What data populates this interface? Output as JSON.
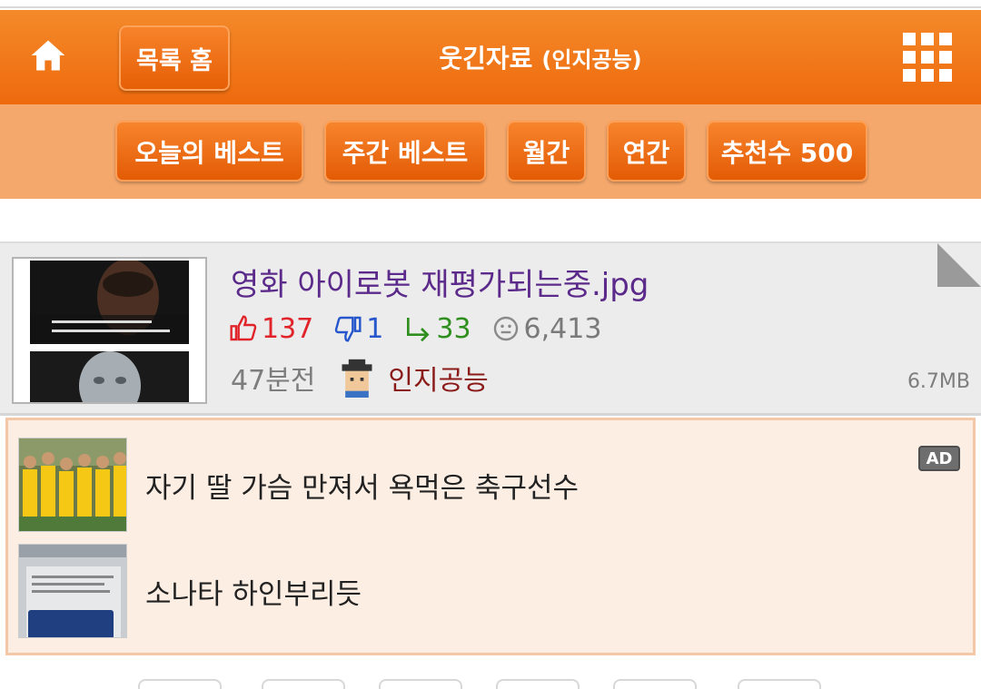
{
  "header": {
    "home_icon": "home-icon",
    "list_home_label": "목록 홈",
    "title": "웃긴자료",
    "subtitle": "(인지공능)",
    "menu_icon": "grid-menu-icon"
  },
  "subnav": {
    "items": [
      {
        "label": "오늘의 베스트"
      },
      {
        "label": "주간 베스트"
      },
      {
        "label": "월간"
      },
      {
        "label": "연간"
      },
      {
        "label": "추천수 500"
      }
    ]
  },
  "post": {
    "title": "영화 아이로봇 재평가되는중.jpg",
    "upvotes": "137",
    "downvotes": "1",
    "replies": "33",
    "views": "6,413",
    "time": "47분전",
    "author": "인지공능",
    "file_size": "6.7MB",
    "colors": {
      "up": "#e0242a",
      "down": "#2556cc",
      "reply": "#2f8f1e",
      "title": "#5b2a8a",
      "author": "#8b1a1a"
    }
  },
  "ads": {
    "badge": "AD",
    "items": [
      {
        "text": "자기 딸 가슴 만져서 욕먹은 축구선수"
      },
      {
        "text": "소나타 하인부리듯"
      }
    ]
  },
  "theme": {
    "accent": "#ee6a0d",
    "subnav_bg": "#f5a86c",
    "ad_bg": "#fdeee4"
  }
}
